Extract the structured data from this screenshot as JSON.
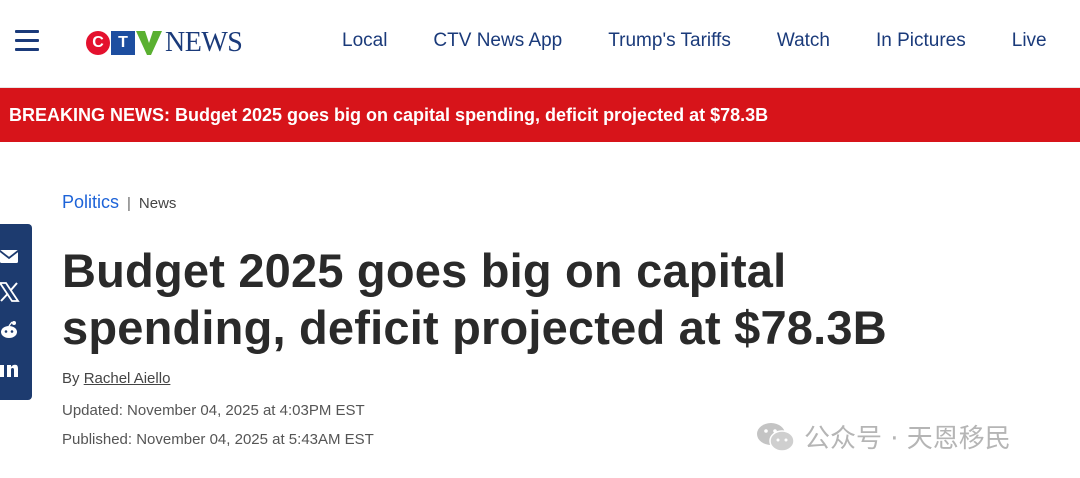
{
  "header": {
    "logo_text": "NEWS",
    "logo_c": "C",
    "logo_t": "T",
    "nav": [
      "Local",
      "CTV News App",
      "Trump's Tariffs",
      "Watch",
      "In Pictures",
      "Live"
    ]
  },
  "breaking": {
    "label": "BREAKING NEWS:",
    "text": "Budget 2025 goes big on capital spending, deficit projected at $78.3B"
  },
  "article": {
    "category": "Politics",
    "separator": "|",
    "subcategory": "News",
    "title": "Budget 2025 goes big on capital spending, deficit projected at $78.3B",
    "by_prefix": "By",
    "author": "Rachel Aiello",
    "updated": "Updated: November 04, 2025 at 4:03PM EST",
    "published": "Published: November 04, 2025 at 5:43AM EST"
  },
  "share_icons": [
    "email-icon",
    "x-icon",
    "reddit-icon",
    "linkedin-icon"
  ],
  "watermark": "公众号 · 天恩移民",
  "colors": {
    "brand_navy": "#1a3a7a",
    "breaking_red": "#d7141a",
    "link_blue": "#1d63d8",
    "share_bg": "#1d3b6f"
  }
}
